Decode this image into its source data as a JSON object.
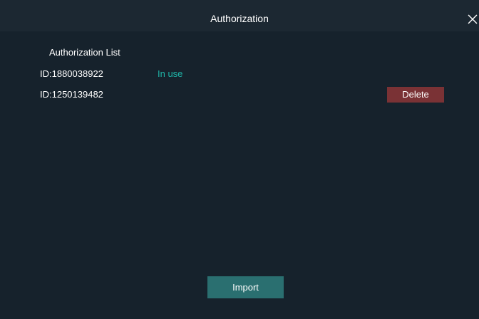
{
  "window": {
    "title": "Authorization",
    "close_icon": "close-icon"
  },
  "authorization_list": {
    "heading": "Authorization List",
    "items": [
      {
        "id": "ID:1880038922",
        "status": "In use",
        "action": ""
      },
      {
        "id": "ID:1250139482",
        "status": "",
        "action": "Delete"
      }
    ]
  },
  "footer": {
    "import_label": "Import"
  },
  "colors": {
    "background": "#16222c",
    "titlebar": "#1c2832",
    "status_accent": "#1fb5a8",
    "delete_button": "#7a3235",
    "import_button": "#2a6f70"
  }
}
